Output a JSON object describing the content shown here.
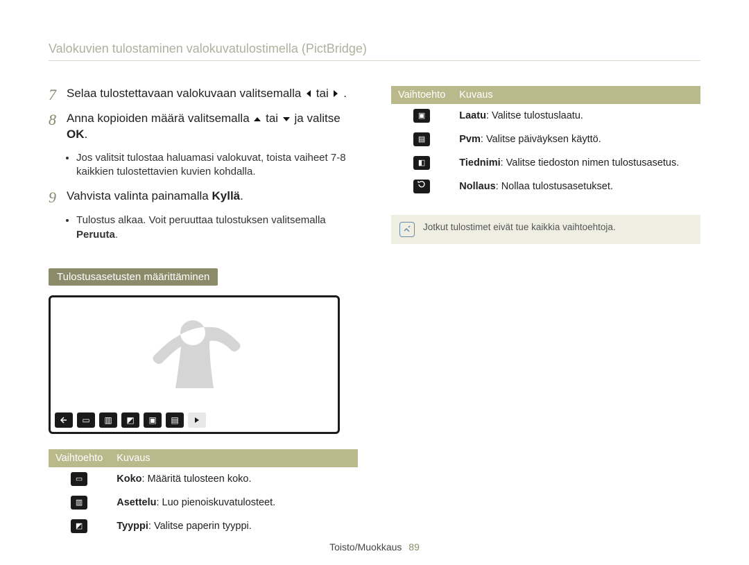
{
  "page_title": "Valokuvien tulostaminen valokuvatulostimella (PictBridge)",
  "steps": {
    "s7": {
      "num": "7",
      "pre": "Selaa tulostettavaan valokuvaan valitsemalla ",
      "or": " tai ",
      "post": "."
    },
    "s8": {
      "num": "8",
      "pre": "Anna kopioiden määrä valitsemalla ",
      "or": " tai ",
      "mid": " ja valitse ",
      "ok": "OK",
      "post": "."
    },
    "s8_bullet": "Jos valitsit tulostaa haluamasi valokuvat, toista vaiheet 7-8 kaikkien tulostettavien kuvien kohdalla.",
    "s9": {
      "num": "9",
      "pre": "Vahvista valinta painamalla ",
      "bold": "Kyllä",
      "post": "."
    },
    "s9_bullet_pre": "Tulostus alkaa. Voit peruuttaa tulostuksen valitsemalla ",
    "s9_bullet_bold": "Peruuta",
    "s9_bullet_post": "."
  },
  "section_heading": "Tulostusasetusten määrittäminen",
  "table_header": {
    "option": "Vaihtoehto",
    "desc": "Kuvaus"
  },
  "options_left": [
    {
      "icon": "size-icon",
      "label": "Koko",
      "desc": ": Määritä tulosteen koko."
    },
    {
      "icon": "layout-icon",
      "label": "Asettelu",
      "desc": ": Luo pienoiskuvatulosteet."
    },
    {
      "icon": "type-icon",
      "label": "Tyyppi",
      "desc": ": Valitse paperin tyyppi."
    }
  ],
  "options_right": [
    {
      "icon": "quality-icon",
      "label": "Laatu",
      "desc": ": Valitse tulostuslaatu."
    },
    {
      "icon": "date-icon",
      "label": "Pvm",
      "desc": ": Valitse päiväyksen käyttö."
    },
    {
      "icon": "filename-icon",
      "label": "Tiednimi",
      "desc": ": Valitse tiedoston nimen tulostusasetus."
    },
    {
      "icon": "reset-icon",
      "label": "Nollaus",
      "desc": ": Nollaa tulostusasetukset."
    }
  ],
  "note_text": "Jotkut tulostimet eivät tue kaikkia vaihtoehtoja.",
  "footer_text": "Toisto/Muokkaus",
  "footer_page": "89"
}
